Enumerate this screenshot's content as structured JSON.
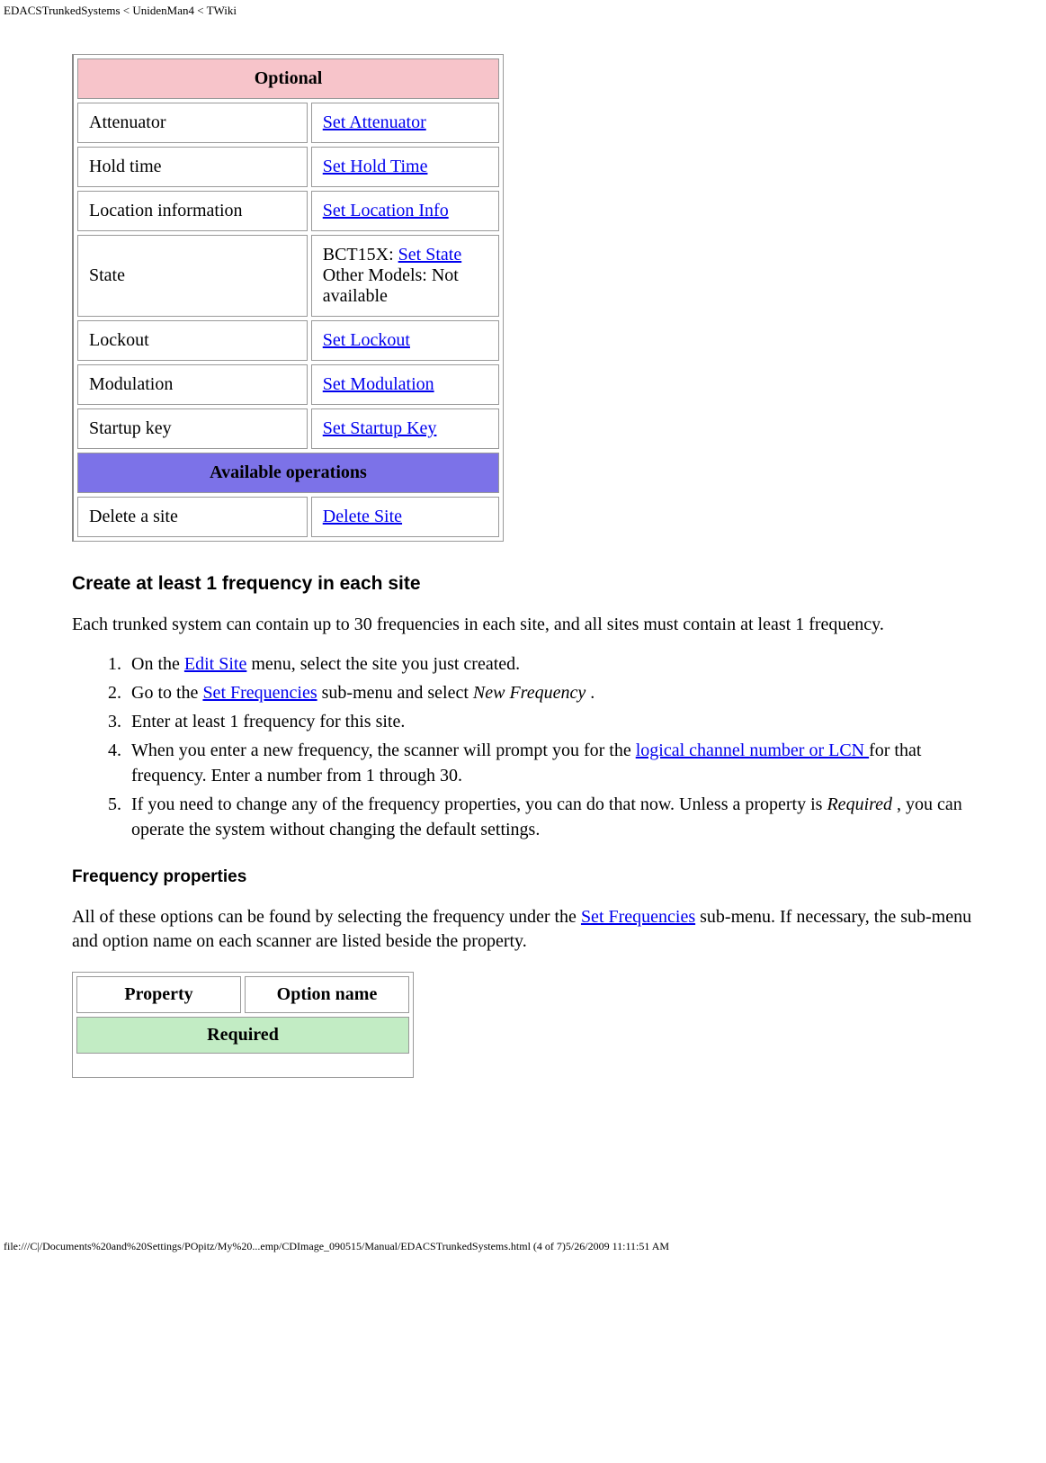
{
  "header": "EDACSTrunkedSystems < UnidenMan4 < TWiki",
  "table1": {
    "optionalHeader": "Optional",
    "rows": [
      {
        "prop": "Attenuator",
        "link": "Set Attenuator"
      },
      {
        "prop": "Hold time",
        "link": "Set Hold Time"
      },
      {
        "prop": "Location information",
        "link": "Set Location Info"
      }
    ],
    "stateRow": {
      "prop": "State",
      "prefix": "BCT15X: ",
      "link": "Set State",
      "line2": "Other Models: Not available"
    },
    "rows2": [
      {
        "prop": "Lockout",
        "link": "Set Lockout"
      },
      {
        "prop": "Modulation",
        "link": "Set Modulation"
      },
      {
        "prop": "Startup key",
        "link": "Set Startup Key"
      }
    ],
    "operationsHeader": "Available operations",
    "deleteRow": {
      "prop": "Delete a site",
      "link": "Delete Site"
    }
  },
  "section1": {
    "heading": "Create at least 1 frequency in each site",
    "para": "Each trunked system can contain up to 30 frequencies in each site, and all sites must contain at least 1 frequency.",
    "li1a": "On the ",
    "li1link": "Edit Site",
    "li1b": " menu, select the site you just created.",
    "li2a": "Go to the ",
    "li2link": "Set Frequencies",
    "li2b": " sub-menu and select ",
    "li2em": "New Frequency",
    "li2c": " .",
    "li3": "Enter at least 1 frequency for this site.",
    "li4a": "When you enter a new frequency, the scanner will prompt you for the ",
    "li4link": "logical channel number or LCN ",
    "li4b": "for that frequency. Enter a number from 1 through 30.",
    "li5a": "If you need to change any of the frequency properties, you can do that now. Unless a property is ",
    "li5em": "Required",
    "li5b": " , you can operate the system without changing the default settings."
  },
  "section2": {
    "heading": "Frequency properties",
    "paraA": "All of these options can be found by selecting the frequency under the ",
    "paraLink": "Set Frequencies",
    "paraB": " sub-menu. If necessary, the sub-menu and option name on each scanner are listed beside the property."
  },
  "table2": {
    "h1": "Property",
    "h2": "Option name",
    "requiredHeader": "Required"
  },
  "footer": "file:///C|/Documents%20and%20Settings/POpitz/My%20...emp/CDImage_090515/Manual/EDACSTrunkedSystems.html (4 of 7)5/26/2009 11:11:51 AM"
}
